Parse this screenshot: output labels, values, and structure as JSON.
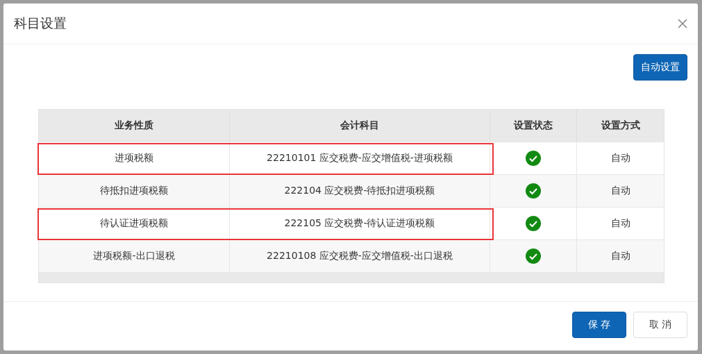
{
  "dialog": {
    "title": "科目设置"
  },
  "auto_button": "自动设置",
  "table": {
    "columns": [
      "业务性质",
      "会计科目",
      "设置状态",
      "设置方式"
    ],
    "rows": [
      {
        "nature": "进项税额",
        "account": "22210101 应交税费-应交增值税-进项税额",
        "configured": true,
        "method": "自动",
        "highlighted": true
      },
      {
        "nature": "待抵扣进项税额",
        "account": "222104 应交税费-待抵扣进项税额",
        "configured": true,
        "method": "自动",
        "highlighted": false
      },
      {
        "nature": "待认证进项税额",
        "account": "222105 应交税费-待认证进项税额",
        "configured": true,
        "method": "自动",
        "highlighted": true
      },
      {
        "nature": "进项税额-出口退税",
        "account": "22210108 应交税费-应交增值税-出口退税",
        "configured": true,
        "method": "自动",
        "highlighted": false
      }
    ]
  },
  "buttons": [
    "保 存",
    "取 消"
  ]
}
